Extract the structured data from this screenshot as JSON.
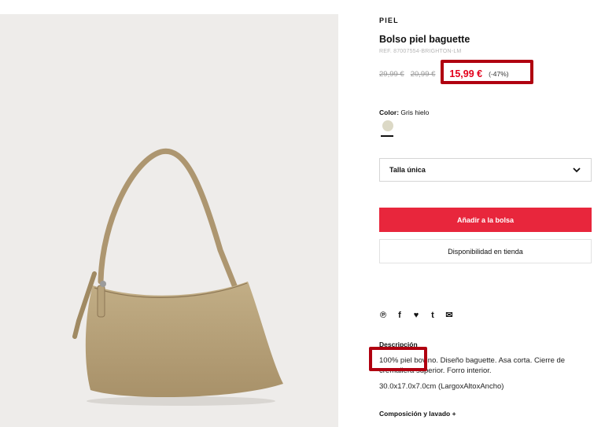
{
  "product": {
    "category": "PIEL",
    "title": "Bolso piel baguette",
    "ref": "REF. 87007554-BRIGHTON-LM",
    "price_original": "29,99 €",
    "price_previous": "20,99 €",
    "price_sale": "15,99 €",
    "discount": "(-47%)"
  },
  "color": {
    "label": "Color:",
    "value": "Gris hielo",
    "swatch": "#dcd9c6"
  },
  "size": {
    "selected": "Talla única"
  },
  "actions": {
    "add_to_bag": "Añadir a la bolsa",
    "store_availability": "Disponibilidad en tienda"
  },
  "share": {
    "icons": [
      "pinterest-icon",
      "facebook-icon",
      "twitter-icon",
      "tumblr-icon",
      "email-icon"
    ],
    "glyphs": [
      "℗",
      "f",
      "♥",
      "t",
      "✉"
    ]
  },
  "description": {
    "heading": "Descripción",
    "text": "100% piel bovino. Diseño baguette. Asa corta. Cierre de cremallera superior. Forro interior.",
    "dimensions": "30.0x17.0x7.0cm (LargoxAltoxAncho)"
  },
  "composition": {
    "heading": "Composición y lavado +"
  },
  "colors": {
    "accent": "#e8263c",
    "sale_price": "#e3001b",
    "highlight": "#b00010",
    "bag": "#b9a47c"
  }
}
